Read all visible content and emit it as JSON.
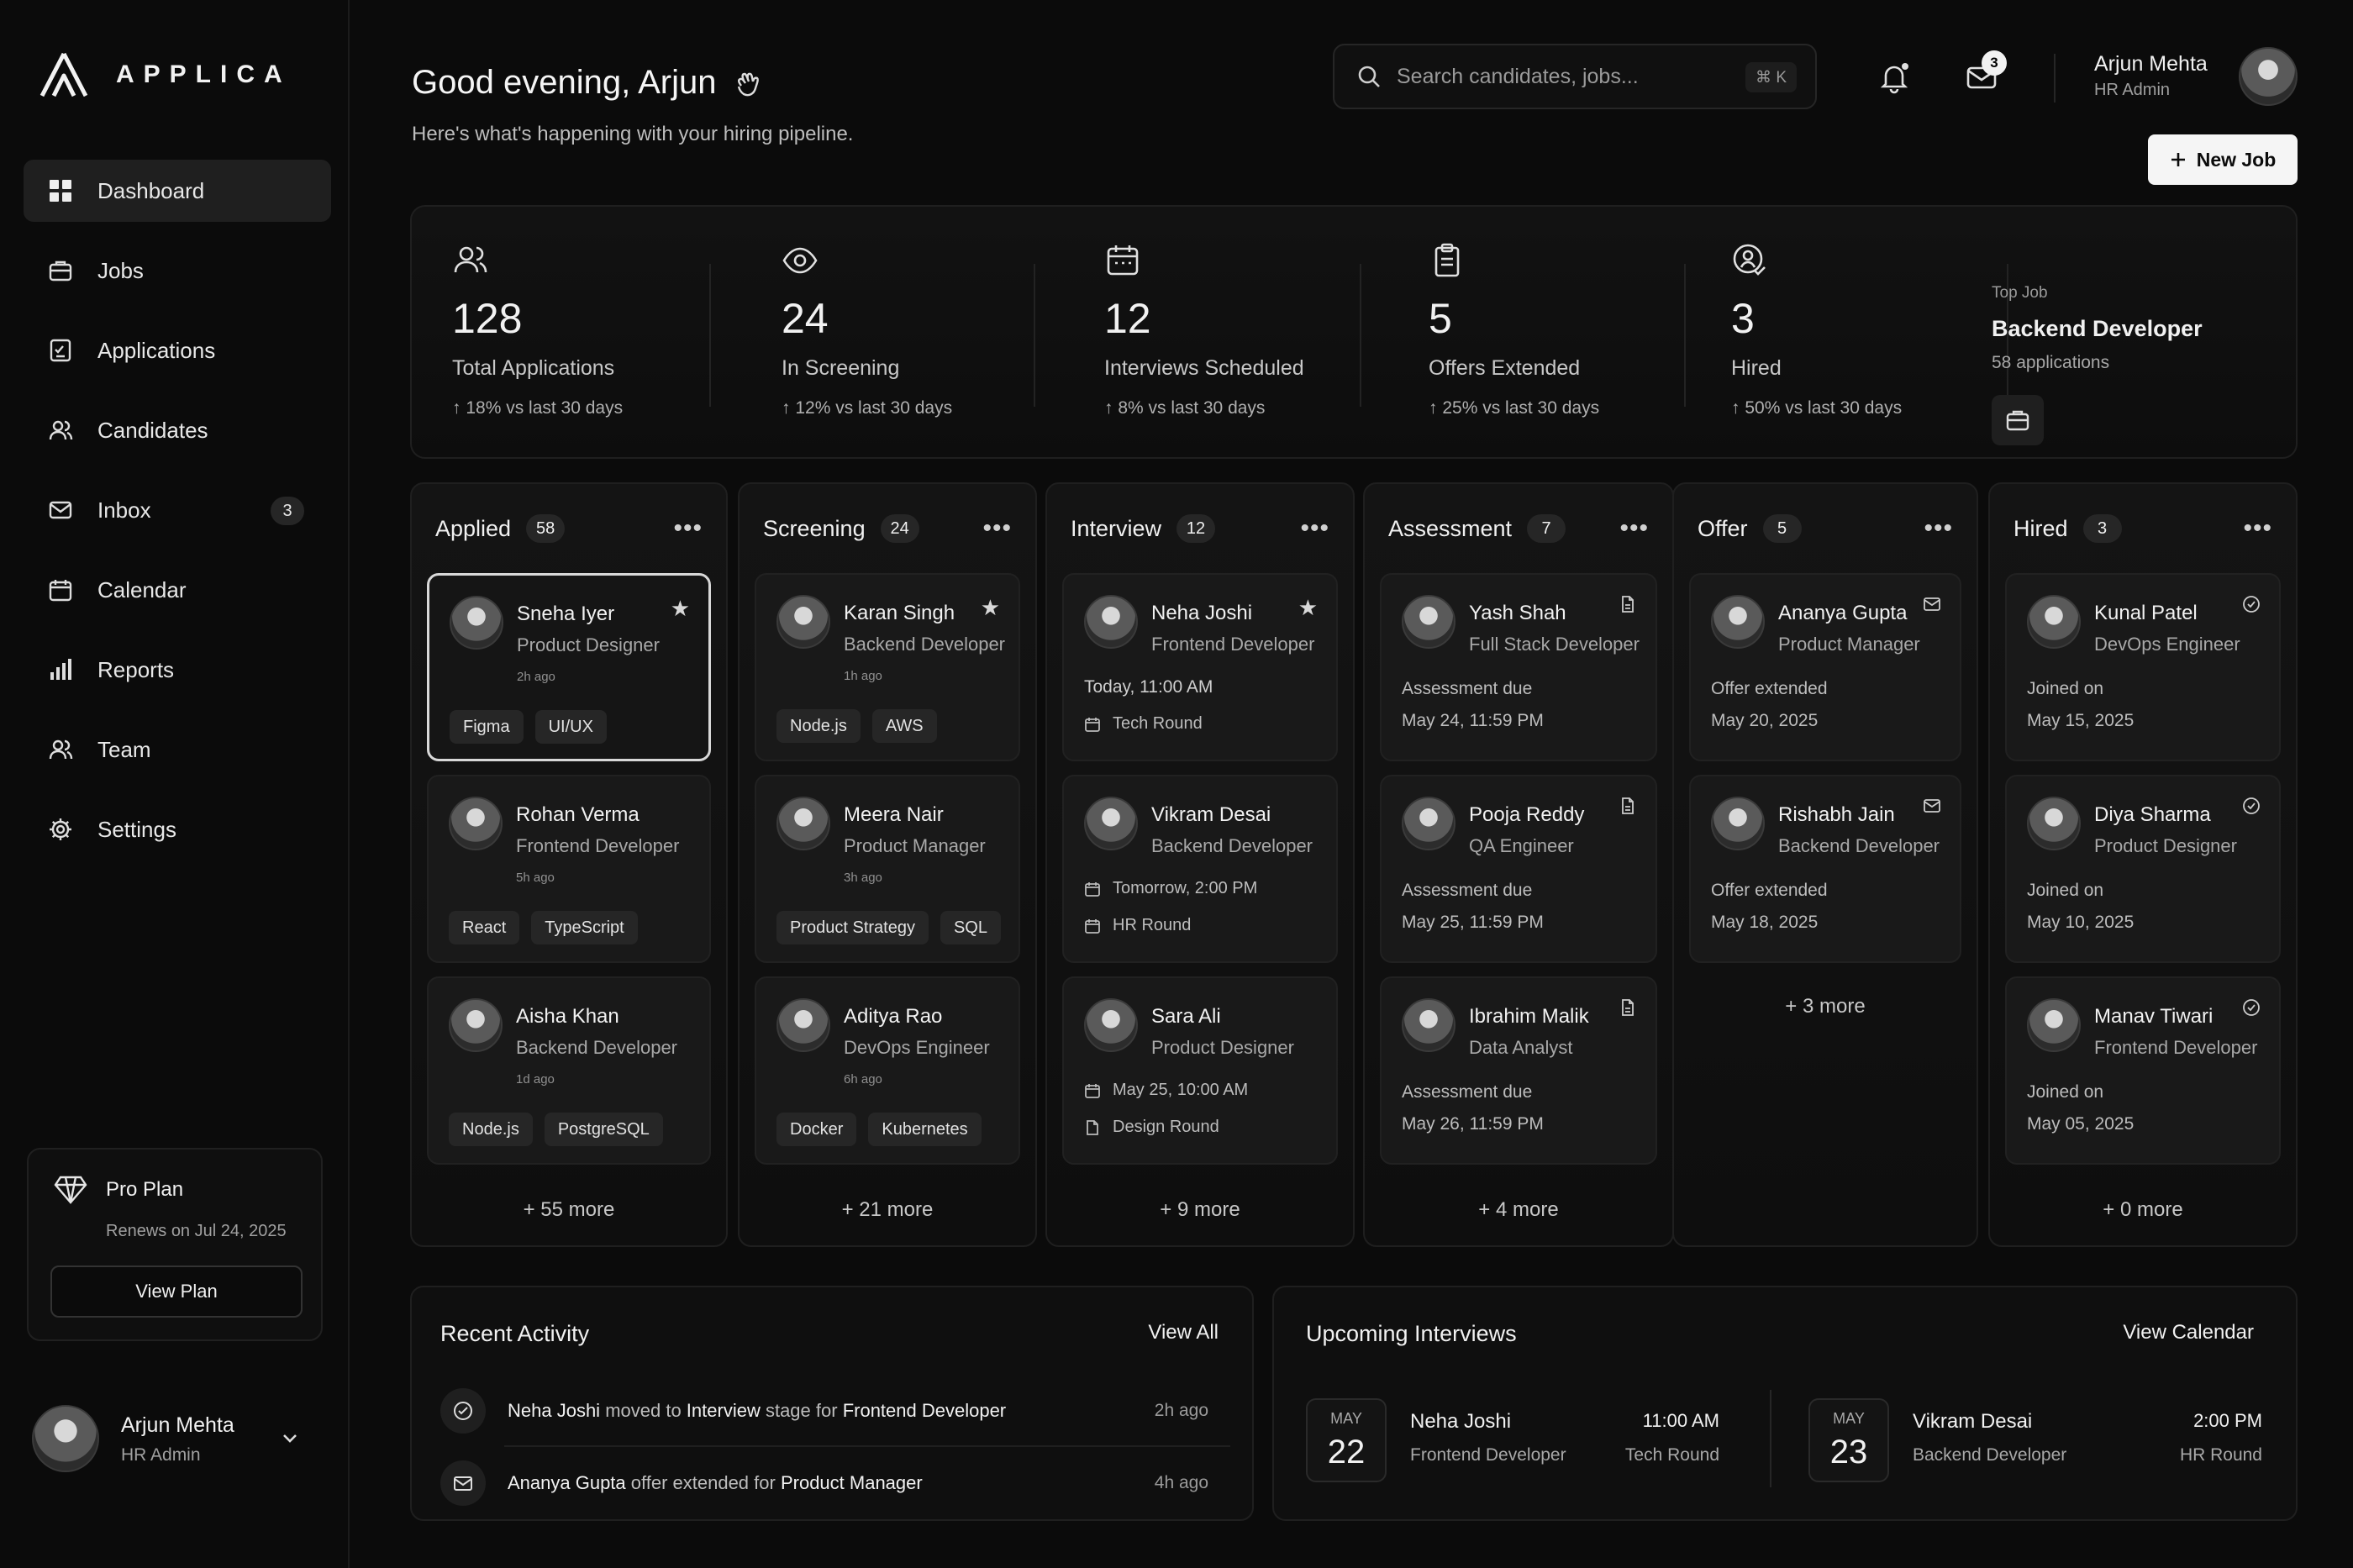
{
  "brand": {
    "name": "APPLICA"
  },
  "sidebar": {
    "items": [
      {
        "label": "Dashboard",
        "icon": "grid-icon"
      },
      {
        "label": "Jobs",
        "icon": "briefcase-icon"
      },
      {
        "label": "Applications",
        "icon": "checklist-icon"
      },
      {
        "label": "Candidates",
        "icon": "users-icon"
      },
      {
        "label": "Inbox",
        "icon": "mail-icon",
        "badge": "3"
      },
      {
        "label": "Calendar",
        "icon": "calendar-icon"
      },
      {
        "label": "Reports",
        "icon": "bar-chart-icon"
      },
      {
        "label": "Team",
        "icon": "team-icon"
      },
      {
        "label": "Settings",
        "icon": "gear-icon"
      }
    ],
    "plan": {
      "title": "Pro Plan",
      "renew": "Renews on Jul 24, 2025",
      "button": "View Plan"
    },
    "user": {
      "name": "Arjun Mehta",
      "role": "HR Admin"
    }
  },
  "header": {
    "greeting": "Good evening, Arjun",
    "subtitle": "Here's what's happening with your hiring pipeline.",
    "search_placeholder": "Search candidates, jobs...",
    "search_shortcut": "⌘ K",
    "mail_badge": "3",
    "user": {
      "name": "Arjun Mehta",
      "role": "HR Admin"
    },
    "new_job": "New Job"
  },
  "stats": [
    {
      "value": "128",
      "label": "Total Applications",
      "trend": "18% vs last 30 days",
      "icon": "users-icon"
    },
    {
      "value": "24",
      "label": "In Screening",
      "trend": "12% vs last 30 days",
      "icon": "eye-icon"
    },
    {
      "value": "12",
      "label": "Interviews Scheduled",
      "trend": "8% vs last 30 days",
      "icon": "calendar-icon"
    },
    {
      "value": "5",
      "label": "Offers Extended",
      "trend": "25% vs last 30 days",
      "icon": "clipboard-icon"
    },
    {
      "value": "3",
      "label": "Hired",
      "trend": "50% vs last 30 days",
      "icon": "user-check-icon"
    }
  ],
  "top_job": {
    "label": "Top Job",
    "title": "Backend Developer",
    "count": "58 applications"
  },
  "pipeline": [
    {
      "title": "Applied",
      "count": "58",
      "more": "+ 55 more",
      "cards": [
        {
          "name": "Sneha Iyer",
          "role": "Product Designer",
          "time": "2h ago",
          "tags": [
            "Figma",
            "UI/UX"
          ]
        },
        {
          "name": "Rohan Verma",
          "role": "Frontend Developer",
          "time": "5h ago",
          "tags": [
            "React",
            "TypeScript"
          ]
        },
        {
          "name": "Aisha Khan",
          "role": "Backend Developer",
          "time": "1d ago",
          "tags": [
            "Node.js",
            "PostgreSQL"
          ]
        }
      ]
    },
    {
      "title": "Screening",
      "count": "24",
      "more": "+ 21 more",
      "cards": [
        {
          "name": "Karan Singh",
          "role": "Backend Developer",
          "time": "1h ago",
          "tags": [
            "Node.js",
            "AWS"
          ]
        },
        {
          "name": "Meera Nair",
          "role": "Product Manager",
          "time": "3h ago",
          "tags": [
            "Product Strategy",
            "SQL"
          ]
        },
        {
          "name": "Aditya Rao",
          "role": "DevOps Engineer",
          "time": "6h ago",
          "tags": [
            "Docker",
            "Kubernetes"
          ]
        }
      ]
    },
    {
      "title": "Interview",
      "count": "12",
      "more": "+ 9 more",
      "cards": [
        {
          "name": "Neha Joshi",
          "role": "Frontend Developer",
          "when": "Today, 11:00 AM",
          "round": "Tech Round"
        },
        {
          "name": "Vikram Desai",
          "role": "Backend Developer",
          "when": "Tomorrow, 2:00 PM",
          "round": "HR Round"
        },
        {
          "name": "Sara Ali",
          "role": "Product Designer",
          "when": "May 25, 10:00 AM",
          "round": "Design Round"
        }
      ]
    },
    {
      "title": "Assessment",
      "count": "7",
      "more": "+ 4 more",
      "cards": [
        {
          "name": "Yash Shah",
          "role": "Full Stack Developer",
          "status": "Assessment due",
          "date": "May 24, 11:59 PM"
        },
        {
          "name": "Pooja Reddy",
          "role": "QA Engineer",
          "status": "Assessment due",
          "date": "May 25, 11:59 PM"
        },
        {
          "name": "Ibrahim Malik",
          "role": "Data Analyst",
          "status": "Assessment due",
          "date": "May 26, 11:59 PM"
        }
      ]
    },
    {
      "title": "Offer",
      "count": "5",
      "more": "+ 3 more",
      "cards": [
        {
          "name": "Ananya Gupta",
          "role": "Product Manager",
          "status": "Offer extended",
          "date": "May 20, 2025"
        },
        {
          "name": "Rishabh Jain",
          "role": "Backend Developer",
          "status": "Offer extended",
          "date": "May 18, 2025"
        }
      ]
    },
    {
      "title": "Hired",
      "count": "3",
      "more": "+ 0 more",
      "cards": [
        {
          "name": "Kunal Patel",
          "role": "DevOps Engineer",
          "status": "Joined on",
          "date": "May 15, 2025"
        },
        {
          "name": "Diya Sharma",
          "role": "Product Designer",
          "status": "Joined on",
          "date": "May 10, 2025"
        },
        {
          "name": "Manav Tiwari",
          "role": "Frontend Developer",
          "status": "Joined on",
          "date": "May 05, 2025"
        }
      ]
    }
  ],
  "recent_activity": {
    "title": "Recent Activity",
    "link": "View All",
    "items": [
      {
        "who": "Neha Joshi",
        "t1": " moved to ",
        "obj": "Interview",
        "t2": " stage for ",
        "obj2": "Frontend Developer",
        "time": "2h ago",
        "icon": "user-check-icon"
      },
      {
        "who": "Ananya Gupta",
        "t1": " offer extended for ",
        "obj": "Product Manager",
        "t2": "",
        "obj2": "",
        "time": "4h ago",
        "icon": "mail-icon"
      }
    ]
  },
  "upcoming": {
    "title": "Upcoming Interviews",
    "link": "View Calendar",
    "items": [
      {
        "month": "MAY",
        "day": "22",
        "name": "Neha Joshi",
        "role": "Frontend Developer",
        "time": "11:00 AM",
        "round": "Tech Round"
      },
      {
        "month": "MAY",
        "day": "23",
        "name": "Vikram Desai",
        "role": "Backend Developer",
        "time": "2:00 PM",
        "round": "HR Round"
      }
    ]
  }
}
